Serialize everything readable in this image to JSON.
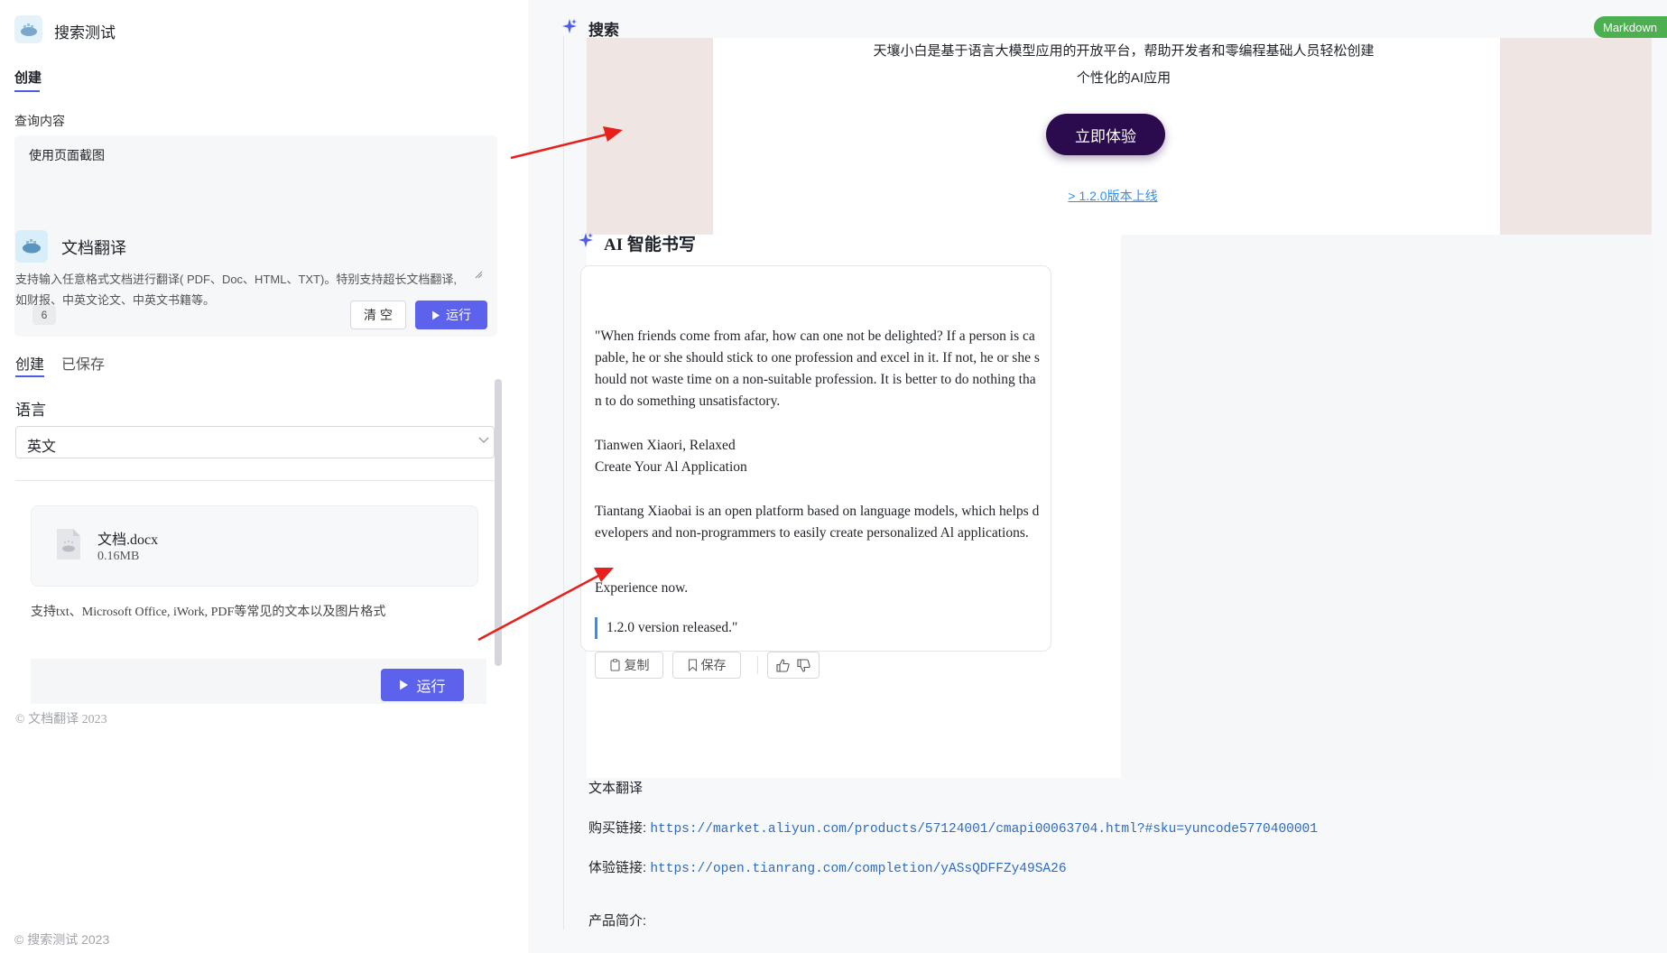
{
  "left_panel": {
    "app_title": "搜索测试",
    "tab_create": "创建",
    "query_label": "查询内容",
    "query_value": "使用页面截图",
    "char_count": "6",
    "clear_button": "清 空",
    "run_button": "运行",
    "footer": "© 搜索测试 2023"
  },
  "right_panel": {
    "header_title": "搜索",
    "markdown_badge": "Markdown",
    "screenshot": {
      "banner": {
        "description_line1": "天壤小白是基于语言大模型应用的开放平台，帮助开发者和零编程基础人员轻松创建",
        "description_line2": "个性化的AI应用",
        "cta_button": "立即体验",
        "version_link": "> 1.2.0版本上线"
      },
      "doc_translate": {
        "title": "文档翻译",
        "description_line1": "支持输入任意格式文档进行翻译( PDF、Doc、HTML、TXT)。特别支持超长文档翻译,",
        "description_line2": "如财报、中英文论文、中英文书籍等。",
        "tab_create": "创建",
        "tab_saved": "已保存",
        "language_label": "语言",
        "language_value": "英文",
        "file_name": "文档.docx",
        "file_size": "0.16MB",
        "support_text": "支持txt、Microsoft Office, iWork, PDF等常见的文本以及图片格式",
        "run_button": "运行",
        "footer": "© 文档翻译 2023"
      },
      "ai_writing": {
        "title": "AI 智能书写",
        "paragraph1": "\"When friends come from afar, how can one not be delighted? If a person is capable, he or she should stick to one profession and excel in it. If not, he or she should not waste time on a non-suitable profession. It is better to do nothing than to do something unsatisfactory.",
        "paragraph2_line1": "Tianwen Xiaori, Relaxed",
        "paragraph2_line2": "Create Your Al Application",
        "paragraph3": "Tiantang Xiaobai is an open platform based on language models, which helps developers and non-programmers to easily create personalized Al applications.",
        "paragraph4": "Experience now.",
        "quote": "1.2.0 version released.\"",
        "copy_button": "复制",
        "save_button": "保存"
      }
    },
    "bottom": {
      "section_title": "文本翻译",
      "purchase_label": "购买链接:",
      "purchase_url": "https://market.aliyun.com/products/57124001/cmapi00063704.html?#sku=yuncode5770400001",
      "trial_label": "体验链接:",
      "trial_url": "https://open.tianrang.com/completion/yASsQDFFZy49SA26",
      "product_intro_label": "产品简介:"
    }
  },
  "colors": {
    "accent": "#5c62ec",
    "banner_button": "#2b0b4d",
    "link": "#2f8ff5",
    "markdown_badge": "#4caf50",
    "annotation_arrow": "#e8201b"
  }
}
